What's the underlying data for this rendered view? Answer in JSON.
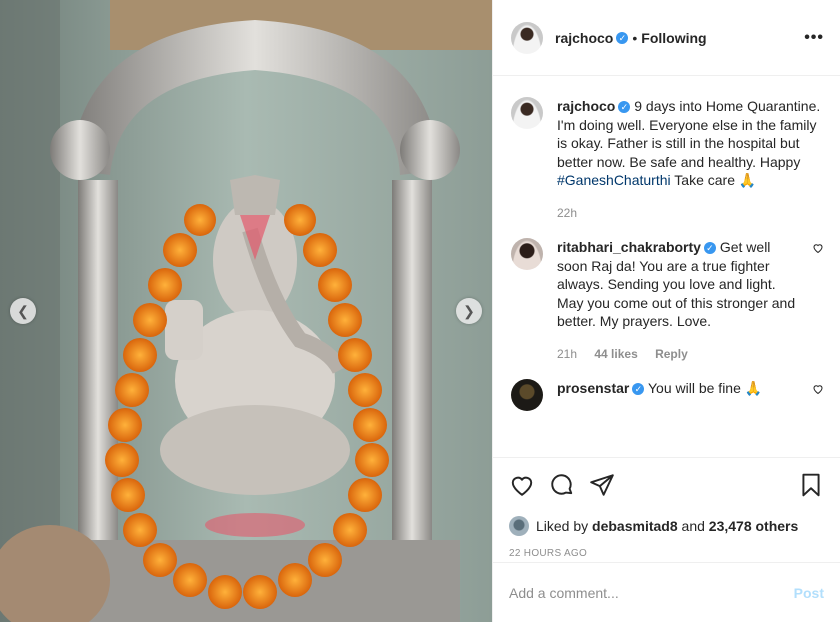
{
  "header": {
    "username": "rajchoco",
    "separator": "•",
    "follow_status": "Following",
    "more_label": "•••"
  },
  "media": {
    "prev_icon": "chevron-left-icon",
    "next_icon": "chevron-right-icon"
  },
  "caption": {
    "username": "rajchoco",
    "text_before": "9 days into Home Quarantine. I'm doing well. Everyone else in the family is okay. Father is still in the hospital but better now. Be safe and healthy. Happy ",
    "hashtag": "#GaneshChaturthi",
    "text_after": " Take care 🙏",
    "time": "22h"
  },
  "comments": [
    {
      "username": "ritabhari_chakraborty",
      "text": "Get well soon Raj da! You are a true fighter always. Sending you love and light. May you come out of this stronger and better. My prayers. Love.",
      "time": "21h",
      "likes": "44 likes",
      "reply": "Reply"
    },
    {
      "username": "prosenstar",
      "text": "You will be fine 🙏",
      "time": "",
      "likes": "",
      "reply": ""
    }
  ],
  "likes": {
    "prefix": "Liked by",
    "user": "debasmitad8",
    "mid": " and ",
    "others": "23,478 others"
  },
  "timestamp": "22 HOURS AGO",
  "add_comment": {
    "placeholder": "Add a comment...",
    "post_label": "Post"
  },
  "colors": {
    "verified": "#3897f0",
    "hashtag": "#00376b",
    "post_disabled": "#b2dffc"
  }
}
